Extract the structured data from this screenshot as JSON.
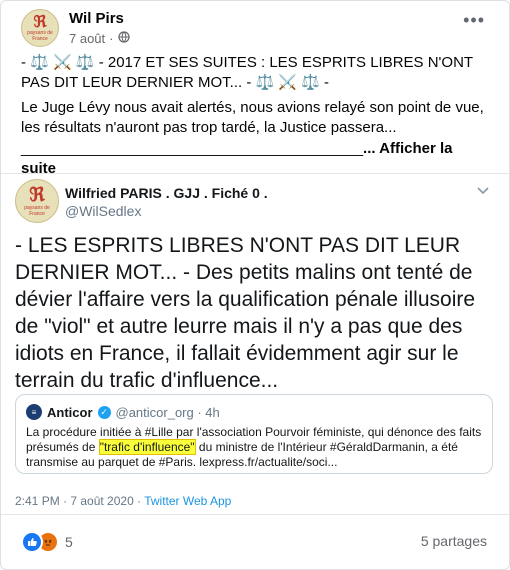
{
  "post": {
    "author": "Wil Pirs",
    "date": "7 août",
    "separator": "·",
    "avatar_monogram": "ℜ",
    "avatar_caption": "paysans de France",
    "text_line1": "- ⚖️ ⚔️ ⚖️ - 2017 ET SES SUITES : LES ESPRITS LIBRES N'ONT PAS DIT LEUR DERNIER MOT... - ⚖️ ⚔️ ⚖️ -",
    "text_line2": "Le Juge Lévy nous avait alertés, nous avions relayé son point de vue, les résultats n'auront pas trop tardé, la Justice passera...",
    "text_line3": "_________________________________________",
    "see_more": "... Afficher la suite"
  },
  "tweet": {
    "name": "Wilfried PARIS . GJJ . Fiché 0 .",
    "handle": "@WilSedlex",
    "body": "- LES ESPRITS LIBRES N'ONT PAS DIT LEUR DERNIER MOT... - Des petits malins ont tenté de dévier l'affaire vers la qualification pénale illusoire de \"viol\" et autre leurre mais il n'y a pas que des idiots en France, il fallait évidemment agir sur le terrain du trafic d'influence...",
    "time": "2:41 PM · 7 août 2020 · ",
    "source": "Twitter Web App",
    "quote": {
      "name": "Anticor",
      "handle": "@anticor_org · 4h",
      "text_before": "La procédure initiée à #Lille par l'association Pourvoir féministe, qui dénonce des faits présumés de ",
      "text_highlight": "\"trafic d'influence\"",
      "text_after": " du ministre de l'Intérieur #GéraldDarmanin, a été transmise au parquet de #Paris. lexpress.fr/actualite/soci..."
    }
  },
  "footer": {
    "reaction_count": "5",
    "shares": "5 partages"
  },
  "icons": {
    "globe": "globe-icon",
    "more": "more-options-icon",
    "chevron": "chevron-down-icon",
    "verified": "verified-badge-icon",
    "like": "like-reaction-icon",
    "angry": "angry-reaction-icon"
  },
  "colors": {
    "link": "#1b95e0",
    "highlight": "#fbff3a",
    "like": "#1877f2",
    "angry": "#e9710f"
  }
}
